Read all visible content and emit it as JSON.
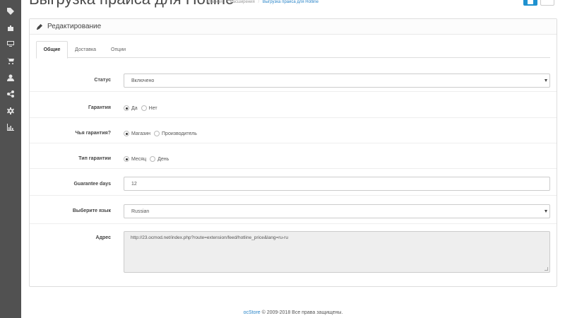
{
  "header": {
    "title": "Выгрузка прайса для Hotline",
    "breadcrumbs": [
      "Главная",
      "Расширения",
      "Выгрузка прайса для Hotline"
    ]
  },
  "sidebar": {
    "icons": [
      "tag-icon",
      "puzzle-icon",
      "desktop-icon",
      "cart-icon",
      "user-icon",
      "share-icon",
      "cog-icon",
      "bar-chart-icon"
    ]
  },
  "panel": {
    "title": "Редактирование",
    "tabs": [
      {
        "label": "Общие",
        "active": true
      },
      {
        "label": "Доставка",
        "active": false
      },
      {
        "label": "Опции",
        "active": false
      }
    ]
  },
  "form": {
    "status": {
      "label": "Статус",
      "value": "Включено"
    },
    "warranty": {
      "label": "Гарантия",
      "options": [
        "Да",
        "Нет"
      ],
      "selected": "Да"
    },
    "whose_warranty": {
      "label": "Чья гарантия?",
      "options": [
        "Магазин",
        "Производитель"
      ],
      "selected": "Магазин"
    },
    "warranty_type": {
      "label": "Тип гарантии",
      "options": [
        "Месяц",
        "День"
      ],
      "selected": "Месяц"
    },
    "guarantee_days": {
      "label": "Guarantee days",
      "value": "12"
    },
    "language": {
      "label": "Выберите язык",
      "value": "Russian"
    },
    "address": {
      "label": "Адрес",
      "value": "http://23.ocmod.net/index.php?route=extension/feed/hotline_price&lang=ru-ru"
    }
  },
  "footer": {
    "brand": "ocStore",
    "text": "© 2009-2018 Все права защищены."
  }
}
